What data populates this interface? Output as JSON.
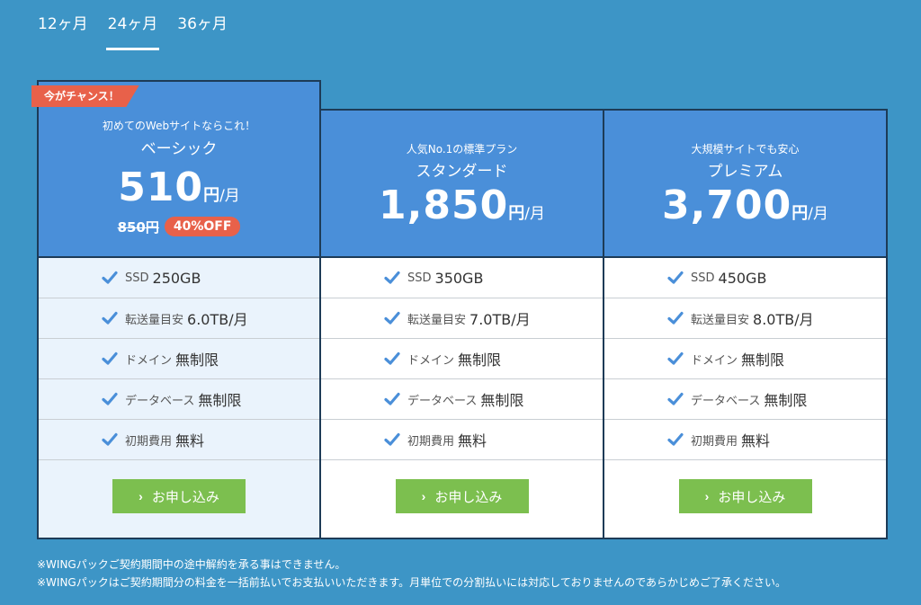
{
  "tabs": [
    {
      "label": "12ヶ月",
      "active": false
    },
    {
      "label": "24ヶ月",
      "active": true
    },
    {
      "label": "36ヶ月",
      "active": false
    }
  ],
  "plans": [
    {
      "ribbon": "今がチャンス！",
      "subtitle": "初めてのWebサイトならこれ！",
      "name": "ベーシック",
      "price": "510",
      "price_unit": "円",
      "price_per": "/月",
      "old_price": "850円",
      "discount": "40%OFF",
      "features": [
        {
          "label": "SSD",
          "value": "250GB"
        },
        {
          "label": "転送量目安",
          "value": "6.0TB/月"
        },
        {
          "label": "ドメイン",
          "value": "無制限"
        },
        {
          "label": "データベース",
          "value": "無制限"
        },
        {
          "label": "初期費用",
          "value": "無料"
        }
      ],
      "button": "お申し込み"
    },
    {
      "subtitle": "人気No.1の標準プラン",
      "name": "スタンダード",
      "price": "1,850",
      "price_unit": "円",
      "price_per": "/月",
      "features": [
        {
          "label": "SSD",
          "value": "350GB"
        },
        {
          "label": "転送量目安",
          "value": "7.0TB/月"
        },
        {
          "label": "ドメイン",
          "value": "無制限"
        },
        {
          "label": "データベース",
          "value": "無制限"
        },
        {
          "label": "初期費用",
          "value": "無料"
        }
      ],
      "button": "お申し込み"
    },
    {
      "subtitle": "大規模サイトでも安心",
      "name": "プレミアム",
      "price": "3,700",
      "price_unit": "円",
      "price_per": "/月",
      "features": [
        {
          "label": "SSD",
          "value": "450GB"
        },
        {
          "label": "転送量目安",
          "value": "8.0TB/月"
        },
        {
          "label": "ドメイン",
          "value": "無制限"
        },
        {
          "label": "データベース",
          "value": "無制限"
        },
        {
          "label": "初期費用",
          "value": "無料"
        }
      ],
      "button": "お申し込み"
    }
  ],
  "notes": [
    "※WINGパックご契約期間中の途中解約を承る事はできません。",
    "※WINGパックはご契約期間分の料金を一括前払いでお支払いいただきます。月単位での分割払いには対応しておりませんのであらかじめご了承ください。"
  ],
  "colors": {
    "background": "#3d95c6",
    "card_header": "#4a8fd9",
    "accent_red": "#e8614a",
    "button_green": "#7cbf4f",
    "check_blue": "#4a8fd9"
  },
  "icons": {
    "check": "check-icon",
    "chevron": "chevron-right-icon"
  }
}
